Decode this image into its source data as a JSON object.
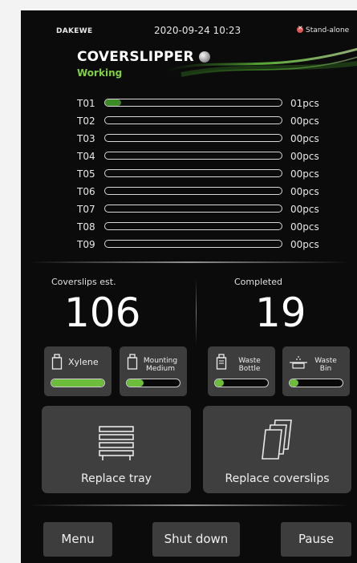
{
  "header": {
    "brand": "DAKEWE",
    "datetime": "2020-09-24 10:23",
    "mode": "Stand-alone",
    "mode_icon": "error-x-icon"
  },
  "device": {
    "title": "COVERSLIPPER",
    "status": "Working",
    "status_color": "#7fd140",
    "led_icon": "status-led-icon"
  },
  "trays": [
    {
      "label": "T01",
      "count": "01pcs",
      "level": 0.09
    },
    {
      "label": "T02",
      "count": "00pcs",
      "level": 0
    },
    {
      "label": "T03",
      "count": "00pcs",
      "level": 0
    },
    {
      "label": "T04",
      "count": "00pcs",
      "level": 0
    },
    {
      "label": "T05",
      "count": "00pcs",
      "level": 0
    },
    {
      "label": "T06",
      "count": "00pcs",
      "level": 0
    },
    {
      "label": "T07",
      "count": "00pcs",
      "level": 0
    },
    {
      "label": "T08",
      "count": "00pcs",
      "level": 0
    },
    {
      "label": "T09",
      "count": "00pcs",
      "level": 0
    }
  ],
  "stats": {
    "estimate_label": "Coverslips est.",
    "estimate_value": "106",
    "completed_label": "Completed",
    "completed_value": "19"
  },
  "reagents": {
    "xylene": {
      "label": "Xylene",
      "level": 1.0,
      "icon": "bottle-icon"
    },
    "mounting": {
      "label_line1": "Mounting",
      "label_line2": "Medium",
      "level": 0.32,
      "icon": "bottle-icon"
    },
    "waste_bottle": {
      "label_line1": "Waste",
      "label_line2": "Bottle",
      "level": 0.17,
      "icon": "waste-bottle-icon"
    },
    "waste_bin": {
      "label_line1": "Waste",
      "label_line2": "Bin",
      "level": 0.17,
      "icon": "waste-bin-icon"
    }
  },
  "actions": {
    "replace_tray": "Replace tray",
    "replace_coverslips": "Replace coverslips",
    "tray_icon": "tray-stack-icon",
    "coverslips_icon": "coverslips-icon"
  },
  "footer": {
    "menu": "Menu",
    "shutdown": "Shut down",
    "pause": "Pause"
  },
  "colors": {
    "accent_green": "#6cbd3a",
    "tray_fill": "#3f8a28",
    "panel": "#3d3d3d",
    "background": "#0b0b0b"
  }
}
